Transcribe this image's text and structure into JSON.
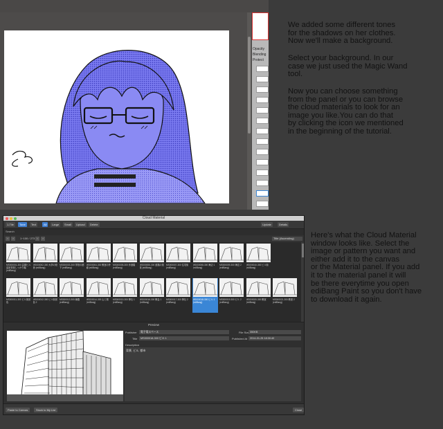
{
  "side_panel": {
    "opacity_label": "Opacity",
    "blending_label": "Blending",
    "protect_label": "Protect"
  },
  "tutorial": {
    "paragraph1": "We added some different tones\nfor the shadows on her clothes.\nNow we'll make a background.",
    "paragraph2": "Select your background. In our\ncase we just used the Magic Wand\ntool.",
    "paragraph3": "Now you can choose something\nfrom the panel or you can browse\nthe cloud materials to look for an\nimage you like.You can do that\nby clicking the icon we mentioned\nin the beginning of the tutorial.",
    "paragraph4": "Here's what the Cloud Material\nwindow looks like. Select the\nimage or pattern you want and\neither add it to the canvas\nor the Material panel. If you add\nit to the material panel it will\nbe there everytime you open\nediBang Paint so you don't have\nto download it again."
  },
  "cloud_material": {
    "window_title": "Cloud Material",
    "toolbar": {
      "btn1": "1-Tile",
      "btn2": "Tone",
      "btn3": "Text",
      "btn4": "All",
      "btn5": "Large",
      "btn6": "Small",
      "btn7": "Upload",
      "btn8": "Delete",
      "right1": "Update",
      "right2": "Details"
    },
    "search_label": "Search",
    "pager_text": "1~100 / 273",
    "sort_label": "Title (Ascending)",
    "tiles_row1": [
      "MS000001-300 高層ビル遠景背景しっかり編 (ediBang)",
      "MS000002-300 大学の校舎 (ediBang)",
      "MS000003-300 学校の廊下 (ediBang)",
      "MS000004-300 教室の外観 (ediBang)",
      "MS000005-300 歩道橋 (ediBang)",
      "MS000006-300 道路の風景 (ediBang)",
      "MS000007-300 住宅街 (ediBang)",
      "MS000008-300 海辺 1 (ediBang)",
      "MS000009-300 海辺 2 (ediBang)",
      "MS000010-300 ビル街 (ediBang)"
    ],
    "tiles_row2": [
      "MS000011-300 ビル街景色",
      "MS000012-300 ビル街景色 2",
      "MS000013-300 線路 (ediBang)",
      "MS000014-300 山と湖 (ediBang)",
      "MS000015-300 神社 1 (ediBang)",
      "MS000016-300 教会 1 (ediBang)",
      "MS000017-300 神社 2 (ediBang)",
      "MS000018-300 ビル 1 (ediBang)",
      "MS000019-300 ビル 2 (ediBang)",
      "MS000020-300 教室 (ediBang)",
      "MS000021-300 教室 2 (ediBang)"
    ],
    "preview": {
      "label": "Preview",
      "publisher_label": "Publisher",
      "publisher_value": "電子電スペース",
      "filesize_label": "File Size",
      "filesize_value": "350KB",
      "title_label": "Title",
      "title_value": "MS000018-300 ビル 1",
      "published_label": "Published At",
      "published_value": "2014-01-25 18:30:40",
      "description_label": "Description",
      "description_value": "背景, ビル, 都市"
    },
    "footer": {
      "paste_button": "Paste to Canvas",
      "stock_button": "Stock to My List",
      "close_button": "Close"
    }
  },
  "colors": {
    "tone_blue": "#6a6ae8",
    "selection_blue": "#3a86d6",
    "background": "#3b3b3b"
  }
}
